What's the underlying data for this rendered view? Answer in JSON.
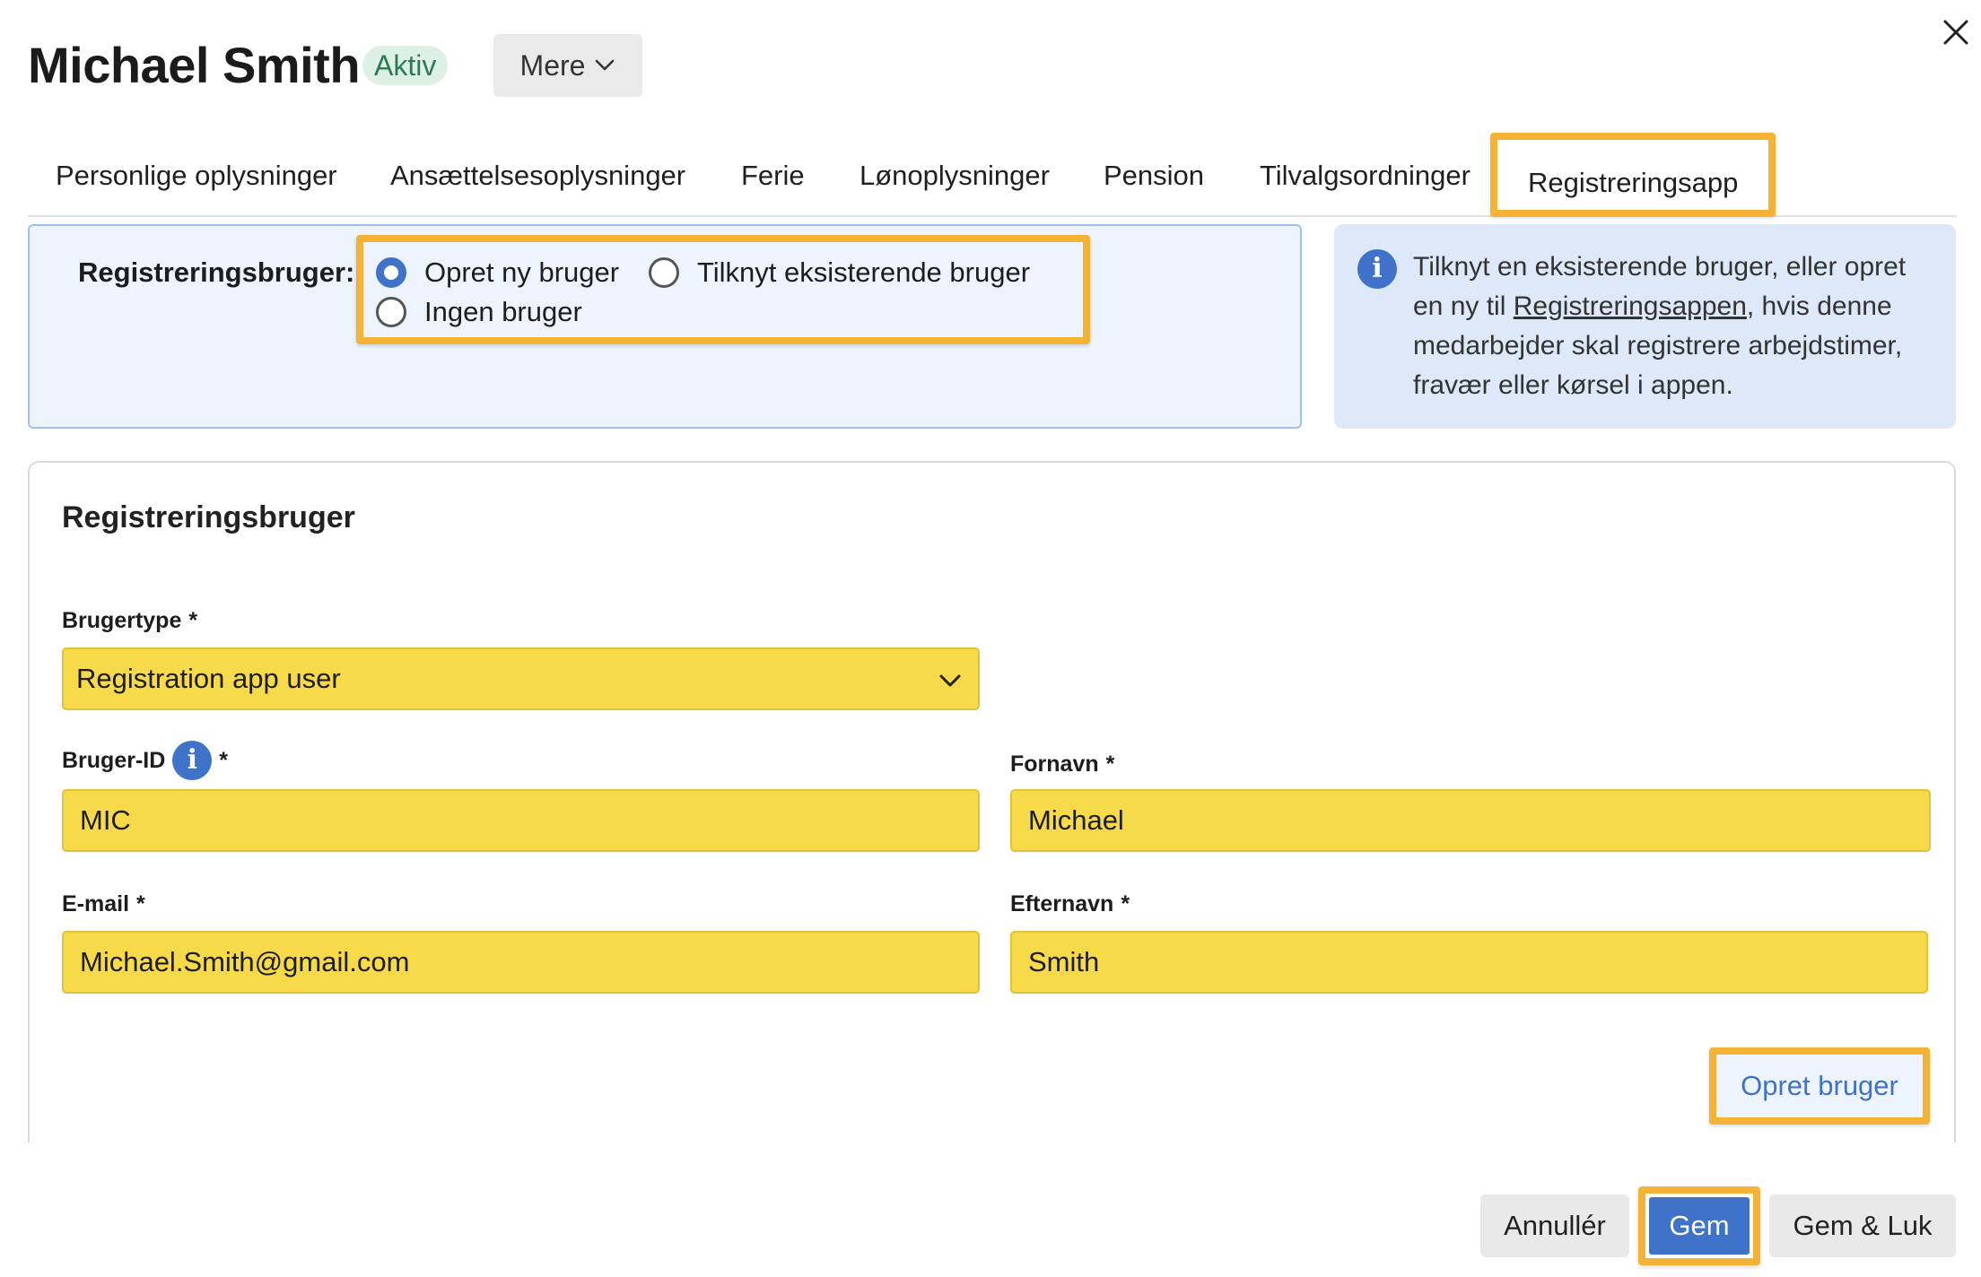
{
  "header": {
    "title": "Michael Smith",
    "status_badge": "Aktiv",
    "more_label": "Mere"
  },
  "tabs": [
    {
      "label": "Personlige oplysninger"
    },
    {
      "label": "Ansættelsesoplysninger"
    },
    {
      "label": "Ferie"
    },
    {
      "label": "Lønoplysninger"
    },
    {
      "label": "Pension"
    },
    {
      "label": "Tilvalgsordninger"
    },
    {
      "label": "Registreringsapp",
      "active": true
    }
  ],
  "registration_choice": {
    "label": "Registreringsbruger:",
    "options": [
      {
        "label": "Opret ny bruger",
        "checked": true
      },
      {
        "label": "Tilknyt eksisterende bruger",
        "checked": false
      },
      {
        "label": "Ingen bruger",
        "checked": false
      }
    ]
  },
  "info": {
    "text_before": "Tilknyt en eksisterende bruger, eller opret en ny til ",
    "link": "Registreringsappen",
    "text_after": ", hvis denne medarbejder skal registrere arbejdstimer, fravær eller kørsel i appen."
  },
  "form": {
    "title": "Registreringsbruger",
    "user_type": {
      "label": "Brugertype",
      "required": "*",
      "value": "Registration app user"
    },
    "user_id": {
      "label": "Bruger-ID",
      "required": "*",
      "value": "MIC"
    },
    "first_name": {
      "label": "Fornavn",
      "required": "*",
      "value": "Michael"
    },
    "email": {
      "label": "E-mail",
      "required": "*",
      "value": "Michael.Smith@gmail.com"
    },
    "last_name": {
      "label": "Efternavn",
      "required": "*",
      "value": "Smith"
    },
    "create_user_label": "Opret bruger"
  },
  "footer": {
    "cancel_label": "Annullér",
    "save_label": "Gem",
    "save_close_label": "Gem & Luk"
  },
  "colors": {
    "accent": "#3f72c9",
    "highlight": "#f5b335",
    "field_fill": "#f7da4a",
    "badge_bg": "#dcf1e4"
  }
}
